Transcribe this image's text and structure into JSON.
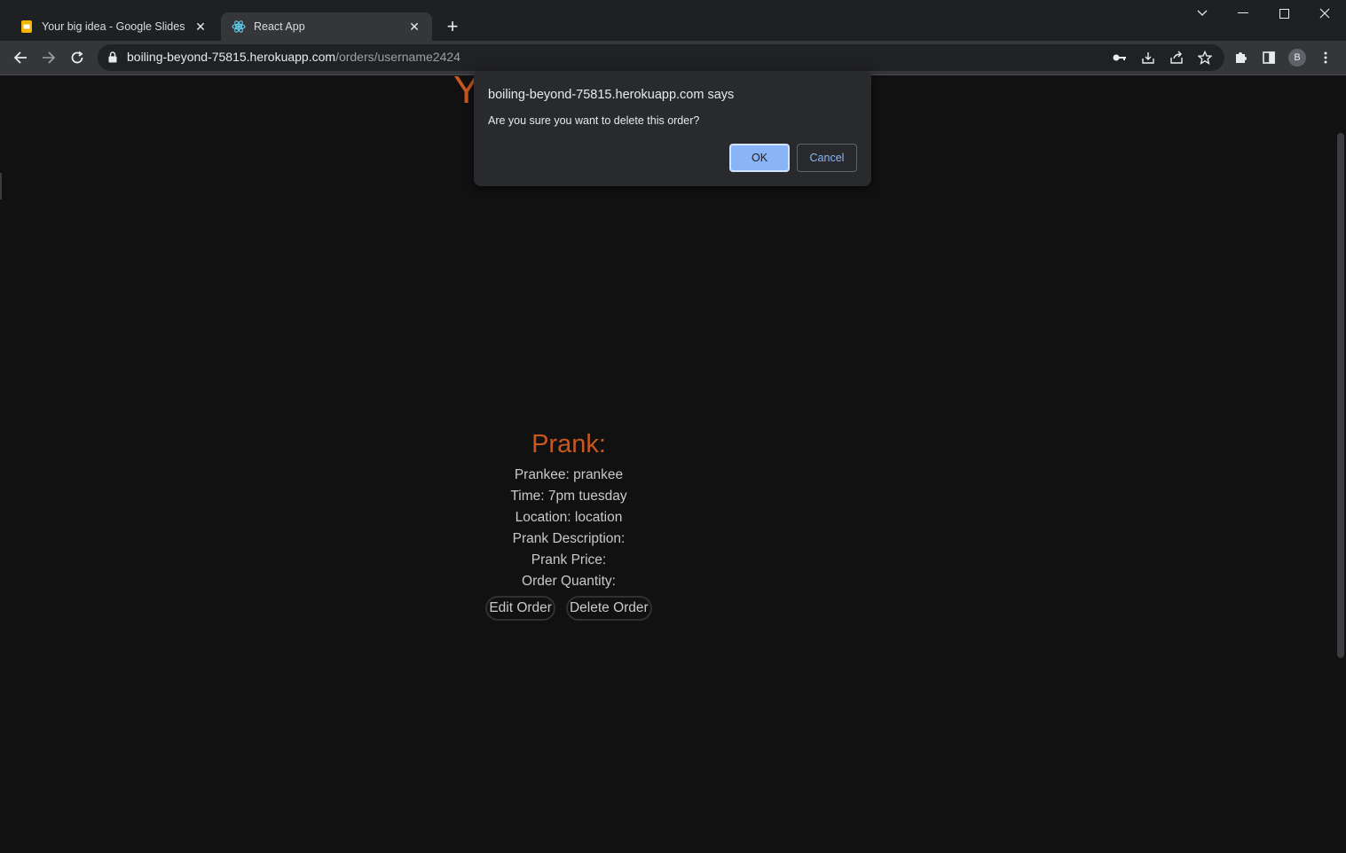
{
  "browser": {
    "tabs": [
      {
        "label": "Your big idea - Google Slides",
        "icon": "google-slides-icon"
      },
      {
        "label": "React App",
        "icon": "react-icon"
      }
    ],
    "url_host": "boiling-beyond-75815.herokuapp.com",
    "url_path": "/orders/username2424",
    "profile_initial": "B"
  },
  "page": {
    "heading_partial": "Y",
    "prank": {
      "title": "Prank:",
      "prankee": "Prankee: prankee",
      "time": "Time: 7pm tuesday",
      "location": "Location: location",
      "description": "Prank Description:",
      "price": "Prank Price:",
      "quantity": "Order Quantity:",
      "edit_label": "Edit Order",
      "delete_label": "Delete Order"
    }
  },
  "dialog": {
    "title": "boiling-beyond-75815.herokuapp.com says",
    "message": "Are you sure you want to delete this order?",
    "ok_label": "OK",
    "cancel_label": "Cancel"
  },
  "colors": {
    "accent_orange": "#c8581e",
    "dialog_blue": "#8ab4f8"
  }
}
